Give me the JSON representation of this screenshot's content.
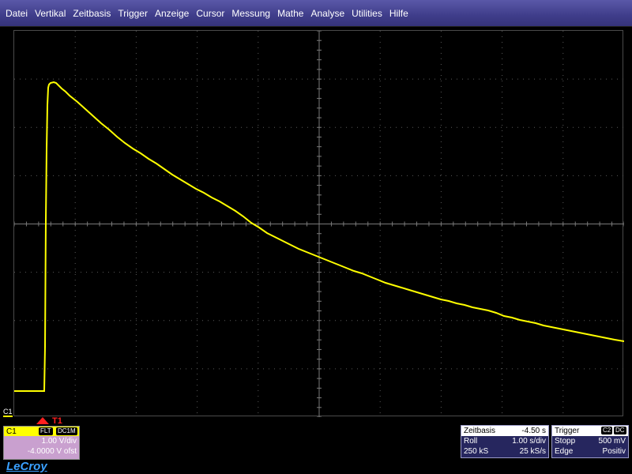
{
  "menu": [
    "Datei",
    "Vertikal",
    "Zeitbasis",
    "Trigger",
    "Anzeige",
    "Cursor",
    "Messung",
    "Mathe",
    "Analyse",
    "Utilities",
    "Hilfe"
  ],
  "channel": {
    "marker_label": "C1",
    "name": "C1",
    "tag_filter": "FLT",
    "tag_coupling": "DC1M",
    "volts_per_div": "1.00 V/div",
    "offset": "-4.0000 V ofst",
    "trace_color": "#ffff00"
  },
  "trigger_marker": {
    "label": "T1"
  },
  "timebase": {
    "title": "Zeitbasis",
    "delay": "-4.50 s",
    "mode": "Roll",
    "time_per_div": "1.00 s/div",
    "samples": "250 kS",
    "sample_rate": "25 kS/s"
  },
  "trigger": {
    "title": "Trigger",
    "source_tag": "C2",
    "coupling_tag": "DC",
    "state": "Stopp",
    "level": "500 mV",
    "type": "Edge",
    "slope": "Positiv"
  },
  "brand": "LeCroy",
  "colors": {
    "menu_bg": "#3f3d8a",
    "trace": "#ffff00",
    "grid": "#6a6a6a",
    "trigger_marker": "#ff2020",
    "channel_panel": "#c9a0cf"
  }
}
